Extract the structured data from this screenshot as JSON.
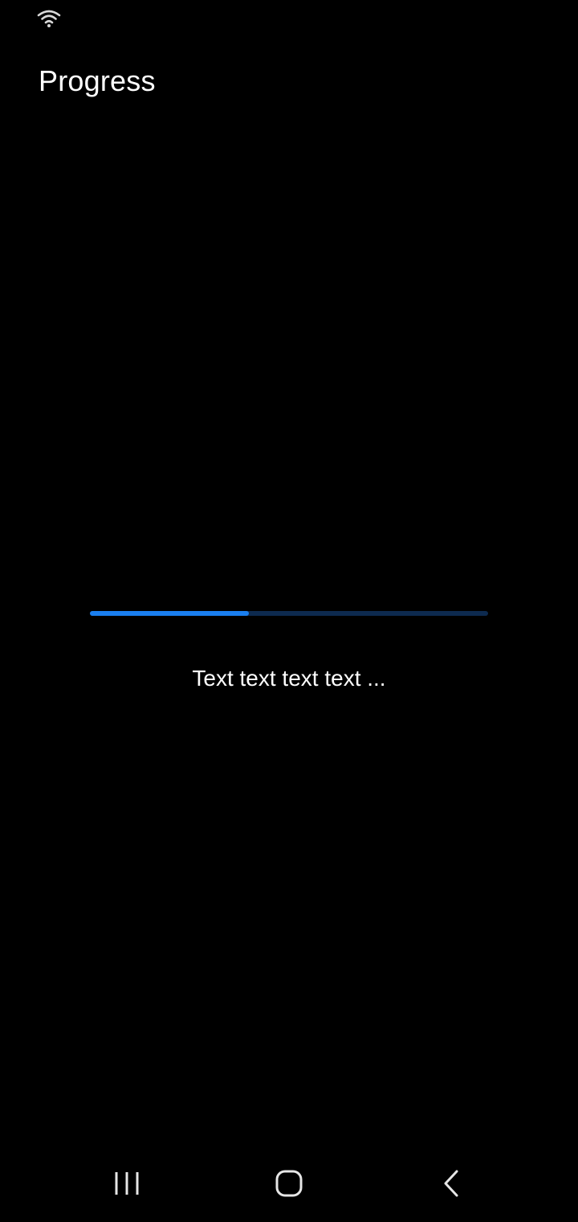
{
  "status_bar": {
    "wifi_icon": "wifi-icon"
  },
  "screen": {
    "title": "Progress"
  },
  "progress": {
    "value_fraction": 0.4,
    "text": "Text text text text ...",
    "fill_color": "#1a7ff0",
    "track_color": "#0d2a4f"
  },
  "nav_bar": {
    "recents_icon": "recents-icon",
    "home_icon": "home-icon",
    "back_icon": "back-icon"
  }
}
